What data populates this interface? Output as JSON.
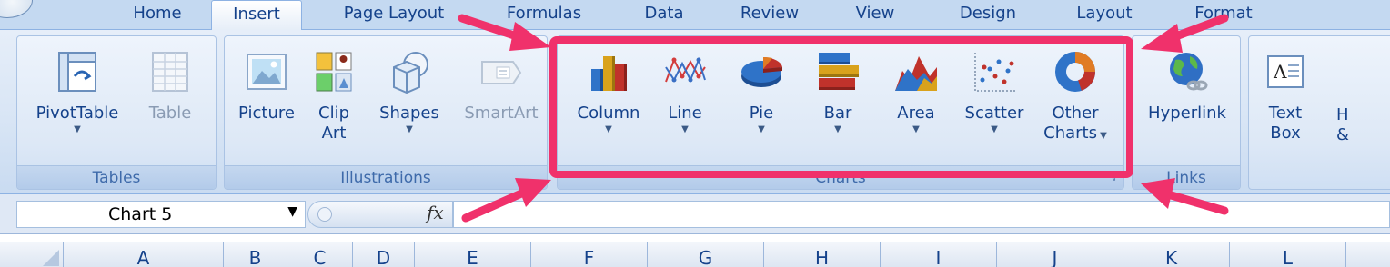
{
  "tabs": [
    {
      "label": "Home",
      "active": false
    },
    {
      "label": "Insert",
      "active": true
    },
    {
      "label": "Page Layout",
      "active": false
    },
    {
      "label": "Formulas",
      "active": false
    },
    {
      "label": "Data",
      "active": false
    },
    {
      "label": "Review",
      "active": false
    },
    {
      "label": "View",
      "active": false
    },
    {
      "label": "Design",
      "active": false
    },
    {
      "label": "Layout",
      "active": false
    },
    {
      "label": "Format",
      "active": false
    }
  ],
  "groups": {
    "tables": {
      "label": "Tables",
      "pivottable": "PivotTable",
      "table": "Table"
    },
    "illustrations": {
      "label": "Illustrations",
      "picture": "Picture",
      "clipart_line1": "Clip",
      "clipart_line2": "Art",
      "shapes": "Shapes",
      "smartart": "SmartArt"
    },
    "charts": {
      "label": "Charts",
      "column": "Column",
      "line": "Line",
      "pie": "Pie",
      "bar": "Bar",
      "area": "Area",
      "scatter": "Scatter",
      "other_line1": "Other",
      "other_line2": "Charts"
    },
    "links": {
      "label": "Links",
      "hyperlink": "Hyperlink"
    },
    "text": {
      "textbox_line1": "Text",
      "textbox_line2": "Box",
      "headerfooter_line1": "H",
      "headerfooter_line2": "&"
    }
  },
  "formula_bar": {
    "name_box": "Chart 5",
    "fx": "fx",
    "formula": ""
  },
  "columns": [
    "A",
    "B",
    "C",
    "D",
    "E",
    "F",
    "G",
    "H",
    "I",
    "J",
    "K",
    "L"
  ],
  "colors": {
    "annotation": "#f0316b",
    "ribbon_text": "#15428b"
  }
}
